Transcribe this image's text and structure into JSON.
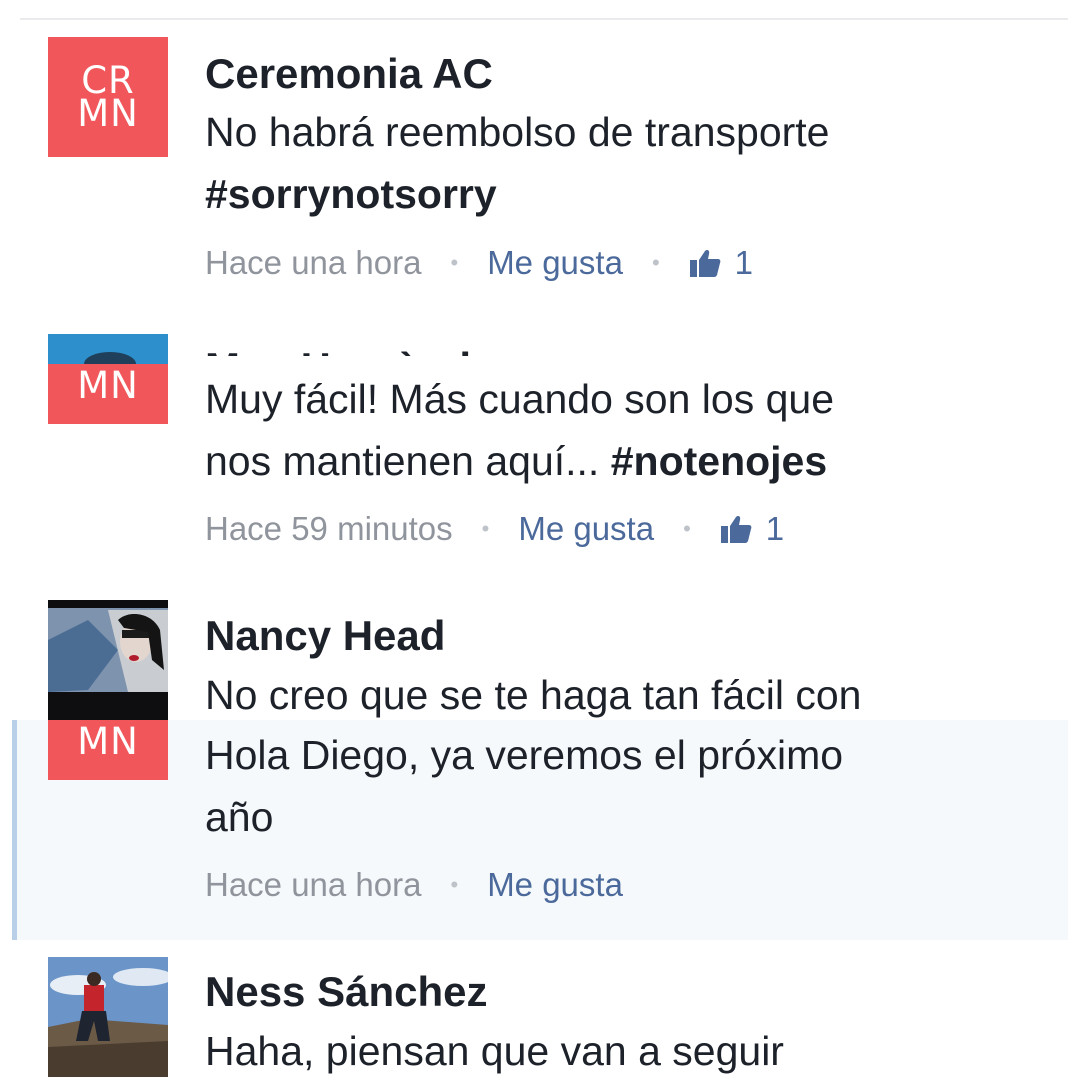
{
  "comments": [
    {
      "name": "Ceremonia AC",
      "avatar_letters": [
        "CR",
        "MN"
      ],
      "text": "No habrá reembolso de transporte",
      "hashtag": "#sorrynotsorry",
      "time": "Hace una hora",
      "like_label": "Me gusta",
      "like_count": "1"
    },
    {
      "name": "Mau Hernàndez",
      "avatar_letters": "MN",
      "text_line1": "Muy fácil! Más cuando son los que",
      "text_line2_prefix": "nos mantienen aquí... ",
      "hashtag": "#notenojes",
      "time": "Hace 59 minutos",
      "like_label": "Me gusta",
      "like_count": "1"
    },
    {
      "name": "Nancy Head",
      "text": "No creo que se te haga tan fácil con"
    },
    {
      "reply": true,
      "avatar_letters": "MN",
      "text_line1": "Hola Diego, ya veremos el próximo",
      "text_line2": "año",
      "time": "Hace una hora",
      "like_label": "Me gusta"
    },
    {
      "name": "Ness Sánchez",
      "text": "Haha, piensan que van a seguir"
    }
  ],
  "colors": {
    "brand_red": "#f0565a",
    "link_blue": "#4b6a9b",
    "meta_gray": "#90949c",
    "reply_bar": "#b9cfe8"
  },
  "icons": {
    "like": "thumbs-up-icon"
  }
}
